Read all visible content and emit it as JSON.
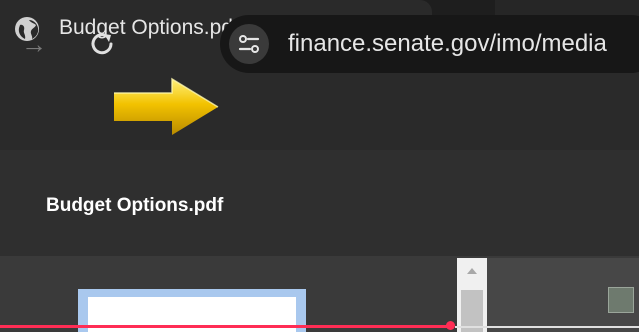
{
  "tab": {
    "title": "Budget Options.pdf",
    "favicon_icon": "globe-icon",
    "close_label": "✕",
    "new_tab_label": "+"
  },
  "toolbar": {
    "forward_icon": "arrow-right-icon",
    "forward_label": "→",
    "reload_icon": "reload-icon",
    "site_info_icon": "tune-icon",
    "url": "finance.senate.gov/imo/media"
  },
  "pdf_viewer": {
    "title": "Budget Options.pdf"
  },
  "colors": {
    "annotation_arrow": "#f2c200",
    "progress_line": "#ff2d55",
    "thumbnail_highlight": "#a9c8ee"
  }
}
